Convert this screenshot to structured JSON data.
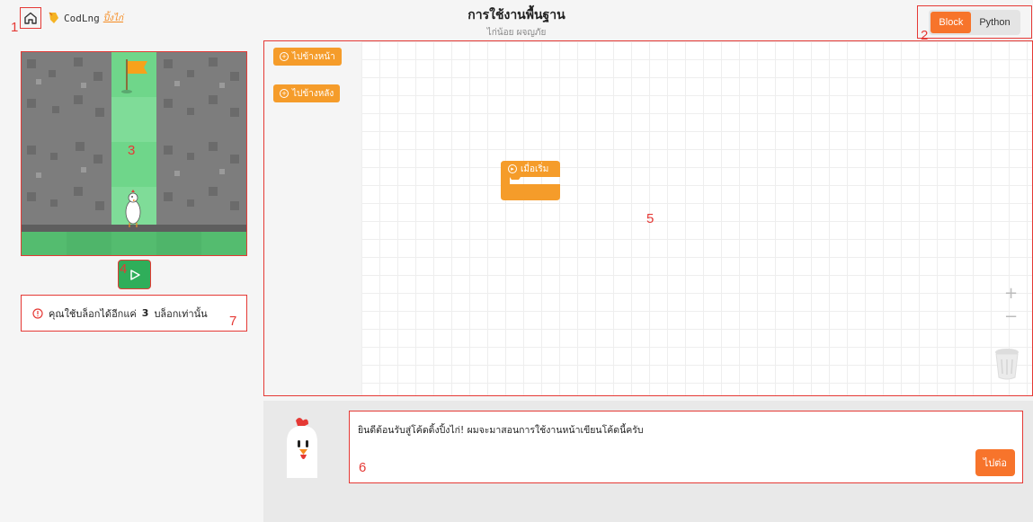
{
  "header": {
    "logo_text": "CodLng",
    "logo_sub": "ปิ้งไก่",
    "title": "การใช้งานพื้นฐาน",
    "subtitle": "ไก่น้อย ผจญภัย"
  },
  "language": {
    "options": [
      "Block",
      "Python"
    ],
    "selected": "Block"
  },
  "annotations": {
    "n1": "1",
    "n2": "2",
    "n3": "3",
    "n4": "4",
    "n5": "5",
    "n6": "6",
    "n7": "7"
  },
  "notice": {
    "prefix": "คุณใช้บล็อกได้อีกแค่",
    "count": "3",
    "suffix": "บล็อกเท่านั้น"
  },
  "toolbox": {
    "blocks": [
      {
        "label": "ไปข้างหน้า",
        "icon": "plus-circle-icon"
      },
      {
        "label": "ไปข้างหลัง",
        "icon": "plus-circle-icon"
      }
    ]
  },
  "workspace": {
    "start_block_label": "เมื่อเริ่ม",
    "zoom_in": "+",
    "zoom_out": "−"
  },
  "dialog": {
    "message": "ยินดีต้อนรับสู่โค้ดดิ้งปิ้งไก่! ผมจะมาสอนการใช้งานหน้าเขียนโค้ดนี้ครับ",
    "next_label": "ไปต่อ"
  },
  "colors": {
    "accent": "#f7742b",
    "block": "#f59c2a",
    "run_button": "#2fae5a",
    "annotation": "#e53935",
    "path_tile": "#6fd68a"
  },
  "icons": {
    "home": "home-icon",
    "run": "play-icon",
    "warning": "alert-circle-icon",
    "trash": "trash-icon"
  }
}
